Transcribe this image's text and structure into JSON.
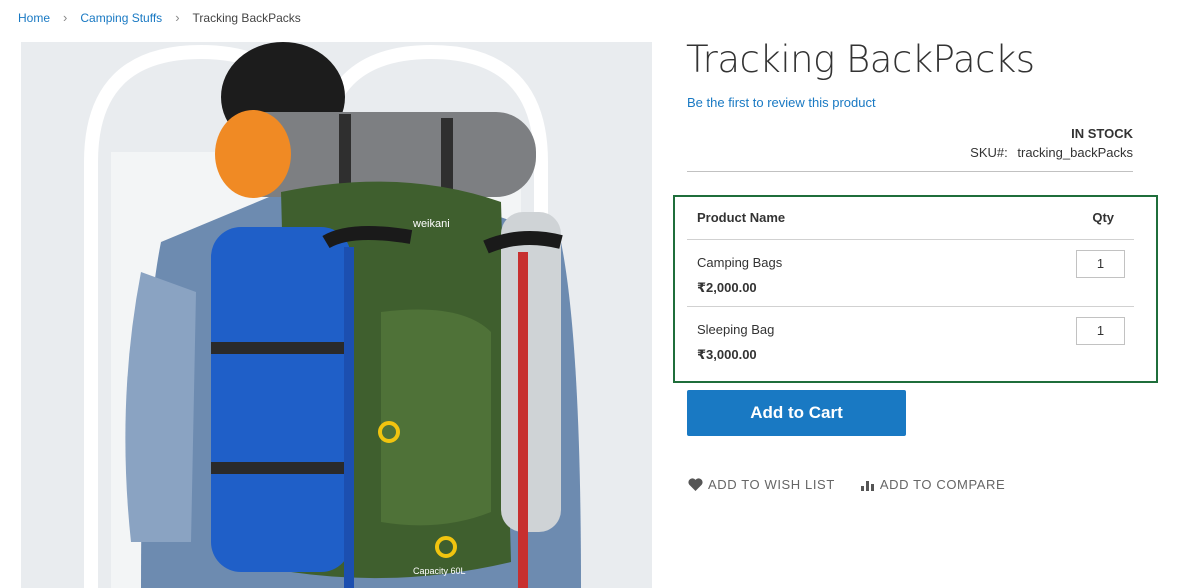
{
  "breadcrumb": {
    "home": "Home",
    "category": "Camping Stuffs",
    "current": "Tracking BackPacks",
    "separator": "›"
  },
  "product": {
    "title": "Tracking BackPacks",
    "review_link": "Be the first to review this product",
    "stock": "IN STOCK",
    "sku_label": "SKU#:",
    "sku_value": "tracking_backPacks"
  },
  "grouped_table": {
    "header_name": "Product Name",
    "header_qty": "Qty",
    "border_color": "#1f6e3b",
    "items": [
      {
        "name": "Camping Bags",
        "price": "₹2,000.00",
        "qty": "1"
      },
      {
        "name": "Sleeping Bag",
        "price": "₹3,000.00",
        "qty": "1"
      }
    ]
  },
  "add_to_cart": {
    "label": "Add to Cart",
    "color": "#1979c3"
  },
  "actions": {
    "wishlist": {
      "label": "ADD TO WISH LIST",
      "icon": "heart-icon"
    },
    "compare": {
      "label": "ADD TO COMPARE",
      "icon": "bar-chart-icon"
    }
  },
  "image": {
    "backpack_text": "weikani",
    "capacity_text": "Capacity 60L"
  }
}
